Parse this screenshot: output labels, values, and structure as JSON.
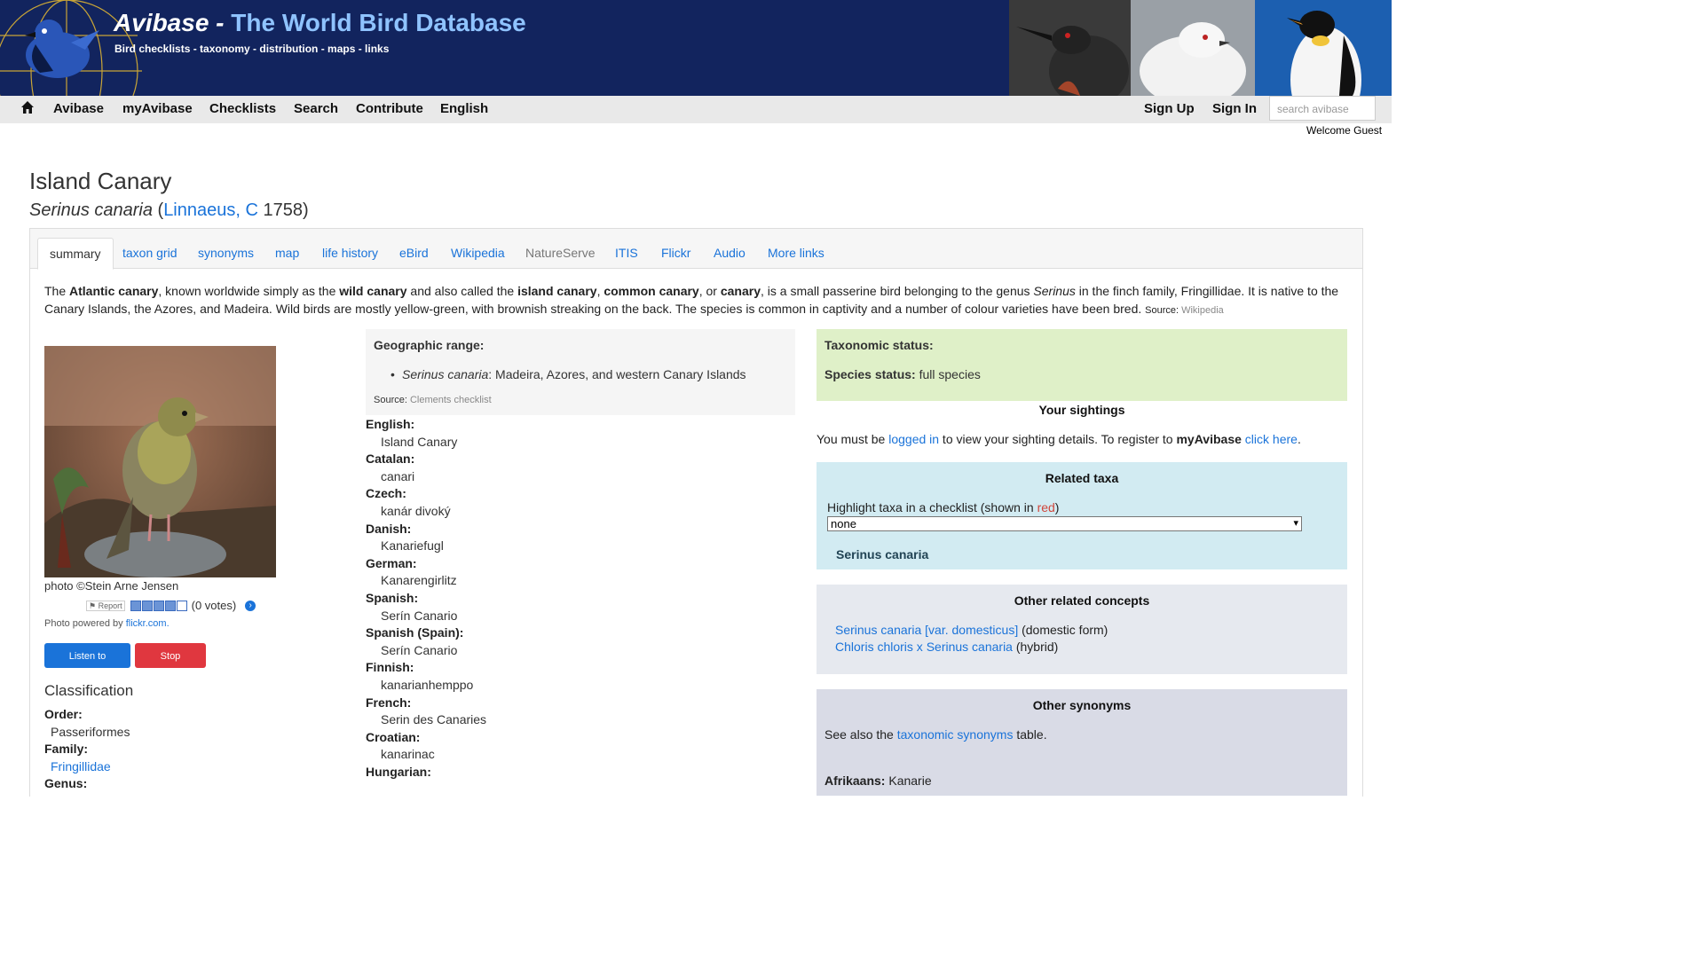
{
  "header": {
    "title_main": "Avibase - ",
    "title_accent": "The World Bird Database",
    "subtitle": "Bird checklists - taxonomy - distribution - maps - links"
  },
  "nav": {
    "items": [
      "Avibase",
      "myAvibase",
      "Checklists",
      "Search",
      "Contribute",
      "English"
    ],
    "sign_up": "Sign Up",
    "sign_in": "Sign In",
    "search_placeholder": "search avibase",
    "welcome": "Welcome Guest"
  },
  "species": {
    "common_name": "Island Canary",
    "scientific_name": "Serinus canaria",
    "author": "Linnaeus, C",
    "year": "1758"
  },
  "tabs": [
    "summary",
    "taxon grid",
    "synonyms",
    "map",
    "life history",
    "eBird",
    "Wikipedia",
    "NatureServe",
    "ITIS",
    "Flickr",
    "Audio",
    "More links"
  ],
  "summary": {
    "t1": "The ",
    "b1": "Atlantic canary",
    "t2": ", known worldwide simply as the ",
    "b2": "wild canary",
    "t3": " and also called the ",
    "b3": "island canary",
    "t4": ", ",
    "b4": "common canary",
    "t5": ", or ",
    "b5": "canary",
    "t6": ", is a small passerine bird belonging to the genus ",
    "i1": "Serinus",
    "t7": " in the finch family, Fringillidae. It is native to the Canary Islands, the Azores, and Madeira. Wild birds are mostly yellow-green, with brownish streaking on the back. The species is common in captivity and a number of colour varieties have been bred. ",
    "source_label": "Source: ",
    "source": "Wikipedia"
  },
  "photo": {
    "credit": "photo ©Stein Arne Jensen",
    "report": "Report",
    "votes": "(0 votes)",
    "rating": 0.7,
    "powered_prefix": "Photo powered by ",
    "powered_link": "flickr.com."
  },
  "buttons": {
    "listen": "Listen to recording",
    "stop": "Stop recording"
  },
  "classification": {
    "title": "Classification",
    "order_label": "Order:",
    "order": "Passeriformes",
    "family_label": "Family:",
    "family": "Fringillidae",
    "genus_label": "Genus:"
  },
  "geo": {
    "title": "Geographic range:",
    "taxon": "Serinus canaria",
    "range": ": Madeira, Azores, and western Canary Islands",
    "source_label": "Source: ",
    "source": "Clements checklist"
  },
  "languages": [
    {
      "lang": "English:",
      "name": "Island Canary"
    },
    {
      "lang": "Catalan:",
      "name": "canari"
    },
    {
      "lang": "Czech:",
      "name": "kanár divoký"
    },
    {
      "lang": "Danish:",
      "name": "Kanariefugl"
    },
    {
      "lang": "German:",
      "name": "Kanarengirlitz"
    },
    {
      "lang": "Spanish:",
      "name": "Serín Canario"
    },
    {
      "lang": "Spanish (Spain):",
      "name": "Serín Canario"
    },
    {
      "lang": "Finnish:",
      "name": "kanarianhemppo"
    },
    {
      "lang": "French:",
      "name": "Serin des Canaries"
    },
    {
      "lang": "Croatian:",
      "name": "kanarinac"
    },
    {
      "lang": "Hungarian:",
      "name": ""
    }
  ],
  "taxonomic": {
    "title": "Taxonomic status:",
    "species_label": "Species status:",
    "species_value": " full species"
  },
  "sightings": {
    "title": "Your sightings",
    "t1": "You must be ",
    "link1": "logged in",
    "t2": " to view your sighting details. To register to ",
    "b1": "myAvibase",
    "t3": " ",
    "link2": "click here",
    "t4": "."
  },
  "related": {
    "title": "Related taxa",
    "highlight_text": "Highlight taxa in a checklist (shown in ",
    "highlight_red": "red",
    "highlight_end": ")",
    "select_value": "none",
    "taxon": "Serinus canaria"
  },
  "other_concepts": {
    "title": "Other related concepts",
    "items": [
      {
        "link": "Serinus canaria [var. domesticus]",
        "note": " (domestic form)"
      },
      {
        "link": "Chloris chloris x Serinus canaria",
        "note": " (hybrid)"
      }
    ]
  },
  "other_synonyms": {
    "title": "Other synonyms",
    "see_prefix": "See also the ",
    "see_link": "taxonomic synonyms",
    "see_suffix": " table.",
    "afrikaans_label": "Afrikaans:",
    "afrikaans": " Kanarie"
  },
  "colors": {
    "header_bg": "#12245e",
    "link": "#1a73d9",
    "tax_bg": "#dff0c8",
    "related_bg": "#d2ebf2"
  }
}
